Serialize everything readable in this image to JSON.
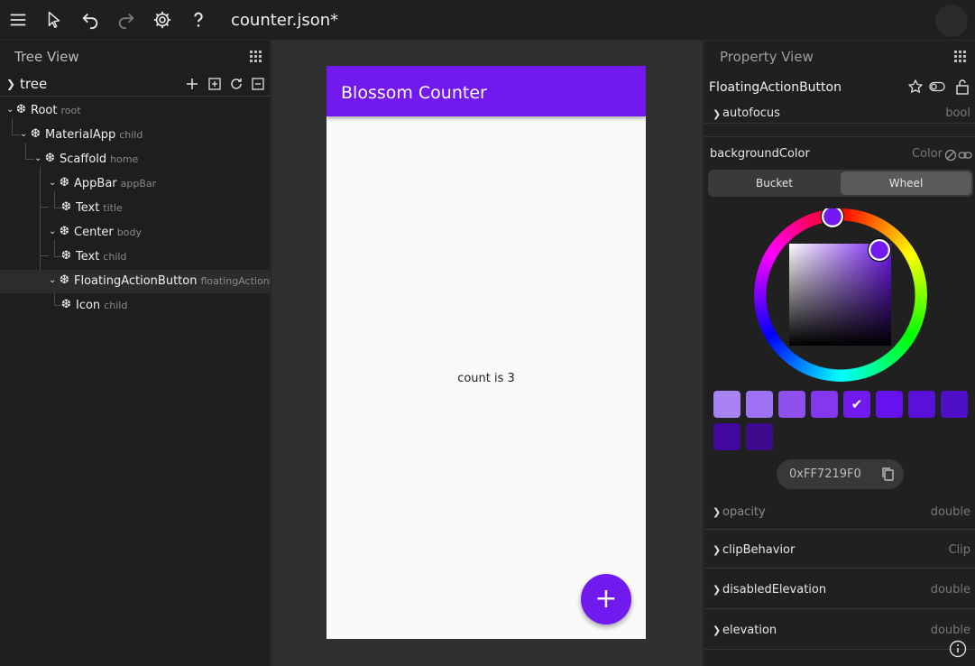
{
  "toolbar": {
    "doc_title": "counter.json*",
    "icons": [
      "menu-icon",
      "cursor-icon",
      "undo-icon",
      "redo-icon",
      "gear-icon",
      "help-icon"
    ]
  },
  "tree_view": {
    "title": "Tree View",
    "root_label": "tree",
    "nodes": [
      {
        "name": "Root",
        "slot": "root",
        "depth": 0
      },
      {
        "name": "MaterialApp",
        "slot": "child",
        "depth": 1
      },
      {
        "name": "Scaffold",
        "slot": "home",
        "depth": 2
      },
      {
        "name": "AppBar",
        "slot": "appBar",
        "depth": 3
      },
      {
        "name": "Text",
        "slot": "title",
        "depth": 4
      },
      {
        "name": "Center",
        "slot": "body",
        "depth": 3
      },
      {
        "name": "Text",
        "slot": "child",
        "depth": 4
      },
      {
        "name": "FloatingActionButton",
        "slot": "floatingActionB",
        "depth": 3
      },
      {
        "name": "Icon",
        "slot": "child",
        "depth": 4
      }
    ]
  },
  "preview": {
    "appbar_title": "Blossom Counter",
    "body_text": "count is 3",
    "fab_symbol": "+",
    "primary_color": "#7219f0"
  },
  "property_view": {
    "title": "Property View",
    "widget_name": "FloatingActionButton",
    "autofocus": {
      "name": "autofocus",
      "type": "bool"
    },
    "background_color": {
      "name": "backgroundColor",
      "type": "Color",
      "tabs": [
        "Bucket",
        "Wheel"
      ],
      "active_tab": "Wheel",
      "hex": "0xFF7219F0",
      "swatches": [
        "#a782f0",
        "#9f72f3",
        "#9050f0",
        "#8537f0",
        "#7219f0",
        "#6612f0",
        "#5a10d8",
        "#4f0ec8",
        "#43099f",
        "#3c0a8a"
      ],
      "selected_swatch": 4
    },
    "properties": [
      {
        "name": "opacity",
        "type": "double",
        "dim": true
      },
      {
        "name": "clipBehavior",
        "type": "Clip",
        "dim": false
      },
      {
        "name": "disabledElevation",
        "type": "double",
        "dim": false
      },
      {
        "name": "elevation",
        "type": "double",
        "dim": false
      }
    ]
  }
}
